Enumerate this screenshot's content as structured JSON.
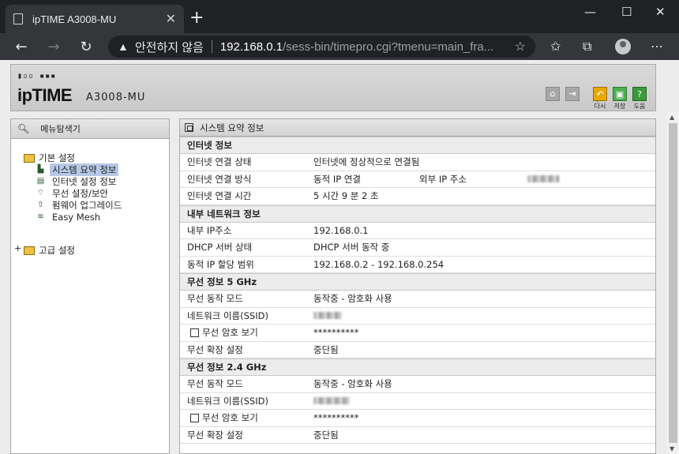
{
  "browser": {
    "tab_title": "ipTIME A3008-MU",
    "tab_close": "✕",
    "new_tab": "+",
    "security_text": "안전하지 않음",
    "url_host": "192.168.0.1",
    "url_path": "/sess-bin/timepro.cgi?tmenu=main_fra...",
    "win_minimize": "—",
    "win_maximize": "☐",
    "win_close": "✕"
  },
  "header": {
    "logo_dots": "▮▫▫ ▪▪▪",
    "logo": "ipTIME",
    "model": "A3008-MU",
    "buttons": [
      {
        "label": "다시",
        "icon": "undo-icon",
        "color": "#e8a800"
      },
      {
        "label": "저장",
        "icon": "save-icon",
        "color": "#4caf50"
      },
      {
        "label": "도움",
        "icon": "help-icon",
        "color": "#3a9a3a"
      }
    ]
  },
  "sidebar": {
    "title": "메뉴탐색기",
    "basic_folder": "기본 설정",
    "items": [
      {
        "label": "시스템 요약 정보",
        "icon": "chart-icon"
      },
      {
        "label": "인터넷 설정 정보",
        "icon": "network-icon"
      },
      {
        "label": "무선 설정/보안",
        "icon": "wireless-icon"
      },
      {
        "label": "펌웨어 업그레이드",
        "icon": "upgrade-icon"
      },
      {
        "label": "Easy Mesh",
        "icon": "mesh-icon"
      }
    ],
    "advanced_folder": "고급 설정",
    "expand": "+"
  },
  "main": {
    "title": "시스템 요약 정보",
    "internet": {
      "header": "인터넷 정보",
      "rows": [
        {
          "k": "인터넷 연결 상태",
          "v": "인터넷에 정상적으로 연결됨"
        },
        {
          "k": "인터넷 연결 방식",
          "v": "동적 IP 연결",
          "k2": "외부 IP 주소"
        },
        {
          "k": "인터넷 연결 시간",
          "v": "5 시간 9 분 2 초"
        }
      ]
    },
    "lan": {
      "header": "내부 네트워크 정보",
      "rows": [
        {
          "k": "내부 IP주소",
          "v": "192.168.0.1"
        },
        {
          "k": "DHCP 서버 상태",
          "v": "DHCP 서버 동작 중"
        },
        {
          "k": "동적 IP 할당 범위",
          "v": "192.168.0.2 -  192.168.0.254"
        }
      ]
    },
    "wifi5": {
      "header": "무선 정보 5 GHz",
      "mode_k": "무선 동작 모드",
      "mode_v": "동작중 - 암호화 사용",
      "ssid_k": "네트워크 이름(SSID)",
      "pw_k": "무선 암호 보기",
      "pw_v": "**********",
      "ext_k": "무선 확장 설정",
      "ext_v": "중단됨"
    },
    "wifi24": {
      "header": "무선 정보 2.4 GHz",
      "mode_k": "무선 동작 모드",
      "mode_v": "동작중 - 암호화 사용",
      "ssid_k": "네트워크 이름(SSID)",
      "pw_k": "무선 암호 보기",
      "pw_v": "**********",
      "ext_k": "무선 확장 설정",
      "ext_v": "중단됨"
    }
  }
}
